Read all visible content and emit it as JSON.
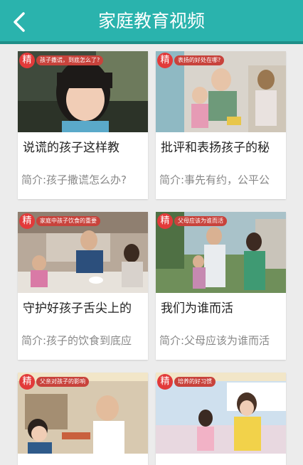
{
  "header": {
    "title": "家庭教育视频",
    "back_icon": "chevron-left-icon"
  },
  "colors": {
    "header": "#2ab3ad",
    "background": "#ececec",
    "badge": "#e23a3a"
  },
  "videos": [
    {
      "title": "说谎的孩子这样教",
      "description": "简介:孩子撒谎怎么办?",
      "badge": "精",
      "caption": "孩子撒谎，到底怎么了?"
    },
    {
      "title": "批评和表扬孩子的秘",
      "description": "简介:事先有约，公平公",
      "badge": "精",
      "caption": "表扬的好处在哪?"
    },
    {
      "title": "守护好孩子舌尖上的",
      "description": "简介:孩子的饮食到底应",
      "badge": "精",
      "caption": "家庭中孩子饮食的重要"
    },
    {
      "title": "我们为谁而活",
      "description": "简介:父母应该为谁而活",
      "badge": "精",
      "caption": "父母应该为谁而活"
    },
    {
      "title": "",
      "description": "",
      "badge": "精",
      "caption": "父亲对孩子的影响"
    },
    {
      "title": "",
      "description": "",
      "badge": "精",
      "caption": "培养的好习惯"
    }
  ]
}
